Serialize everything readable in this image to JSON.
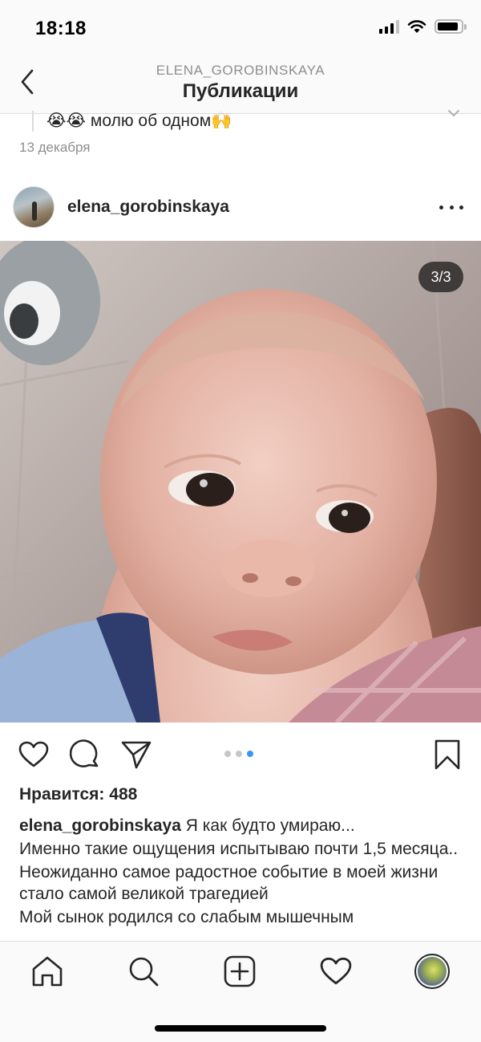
{
  "status_bar": {
    "time": "18:18"
  },
  "header": {
    "username": "ELENA_GOROBINSKAYA",
    "title": "Публикации"
  },
  "previous_post": {
    "caption": "😭😭 молю об одном🙌",
    "date": "13 декабря"
  },
  "post": {
    "username": "elena_gorobinskaya",
    "photo_counter": "3/3",
    "carousel": {
      "total": 3,
      "current": 3
    },
    "likes": "Нравится: 488",
    "caption": {
      "author": "elena_gorobinskaya",
      "lines": [
        "Я как будто умираю...",
        "Именно такие ощущения испытываю почти 1,5 месяца..",
        "Неожиданно самое радостное событие в моей жизни стало самой великой трагедией",
        "Мой сынок родился со слабым мышечным"
      ]
    }
  },
  "icons": {
    "back": "chevron-left-icon",
    "more": "more-horizontal-icon",
    "like": "heart-icon",
    "comment": "comment-icon",
    "share": "send-icon",
    "save": "bookmark-icon",
    "home": "home-icon",
    "search": "search-icon",
    "new_post": "plus-square-icon",
    "activity": "heart-icon",
    "profile": "avatar"
  },
  "colors": {
    "accent": "#3897f0",
    "text": "#262626",
    "secondary_text": "#8e8e8e",
    "bar_background": "#fafafa"
  }
}
